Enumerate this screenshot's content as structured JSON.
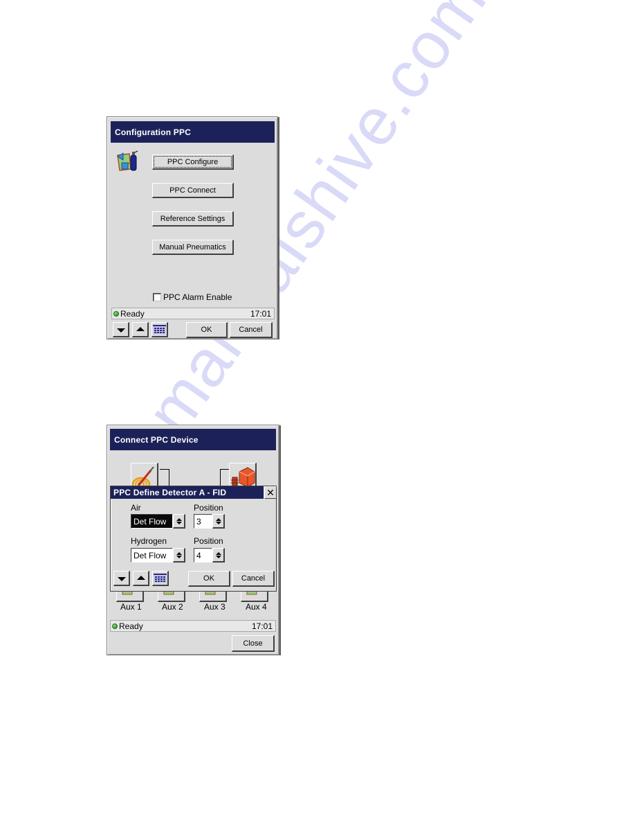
{
  "window1": {
    "title": "Configuration PPC",
    "icon": "ppc-config-icon",
    "buttons": [
      {
        "label": "PPC Configure",
        "focused": true
      },
      {
        "label": "PPC Connect"
      },
      {
        "label": "Reference Settings"
      },
      {
        "label": "Manual Pneumatics"
      }
    ],
    "checkbox": {
      "label": "PPC Alarm Enable",
      "checked": false
    },
    "status": {
      "text": "Ready",
      "time": "17:01",
      "indicator_color": "#2a9a2a"
    },
    "toolbar": {
      "down_icon": "arrow-down-icon",
      "up_icon": "arrow-up-icon",
      "keypad_icon": "keypad-icon",
      "ok_label": "OK",
      "cancel_label": "Cancel"
    }
  },
  "window2": {
    "title": "Connect PPC Device",
    "devices": [
      {
        "icon": "column-coil-icon"
      },
      {
        "icon": "detector-box-icon"
      }
    ],
    "aux": [
      {
        "label": "Aux 1"
      },
      {
        "label": "Aux 2"
      },
      {
        "label": "Aux 3"
      },
      {
        "label": "Aux 4"
      }
    ],
    "status": {
      "text": "Ready",
      "time": "17:01"
    },
    "close_label": "Close",
    "dialog": {
      "title": "PPC Define Detector A - FID",
      "close_glyph": "✕",
      "rows": [
        {
          "gas_label": "Air",
          "gas_value": "Det Flow",
          "gas_selected": true,
          "position_label": "Position",
          "position_value": "3"
        },
        {
          "gas_label": "Hydrogen",
          "gas_value": "Det Flow",
          "gas_selected": false,
          "position_label": "Position",
          "position_value": "4"
        }
      ],
      "ok_label": "OK",
      "cancel_label": "Cancel"
    }
  },
  "watermark": "manualshive.com",
  "colors": {
    "titlebar": "#1c2259",
    "window_bg": "#dcdcdc"
  }
}
